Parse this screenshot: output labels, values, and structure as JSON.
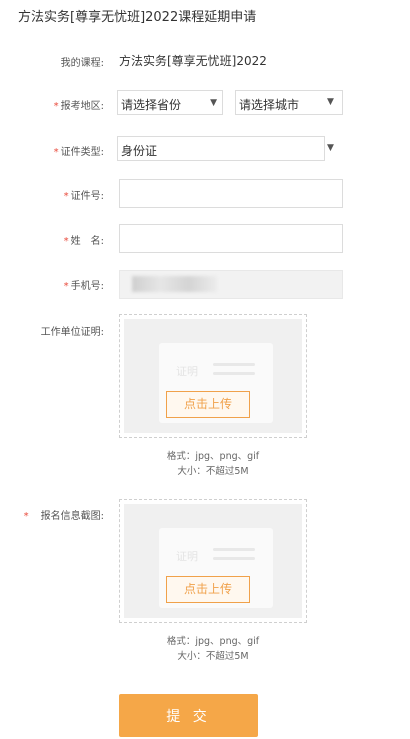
{
  "page": {
    "title": "方法实务[尊享无忧班]2022课程延期申请"
  },
  "form": {
    "course": {
      "label": "我的课程:",
      "value": "方法实务[尊享无忧班]2022"
    },
    "region": {
      "required": "*",
      "label": "报考地区:",
      "province_placeholder": "请选择省份",
      "city_placeholder": "请选择城市"
    },
    "id_type": {
      "required": "*",
      "label": "证件类型:",
      "value": "身份证"
    },
    "id_number": {
      "required": "*",
      "label": "证件号:"
    },
    "name": {
      "required": "*",
      "label": "姓　名:"
    },
    "phone": {
      "required": "*",
      "label": "手机号:"
    },
    "work_proof": {
      "label": "工作单位证明:",
      "card_text": "证明",
      "button": "点击上传",
      "format_hint": "格式：jpg、png、gif",
      "size_hint": "大小：不超过5M"
    },
    "signup_screenshot": {
      "required": "*",
      "label": "报名信息截图:",
      "card_text": "证明",
      "button": "点击上传",
      "format_hint": "格式：jpg、png、gif",
      "size_hint": "大小：不超过5M"
    },
    "submit_label": "提 交"
  },
  "icons": {
    "dropdown": "caret-down-icon"
  },
  "colors": {
    "accent": "#f5a748",
    "required": "#e94a3c"
  }
}
